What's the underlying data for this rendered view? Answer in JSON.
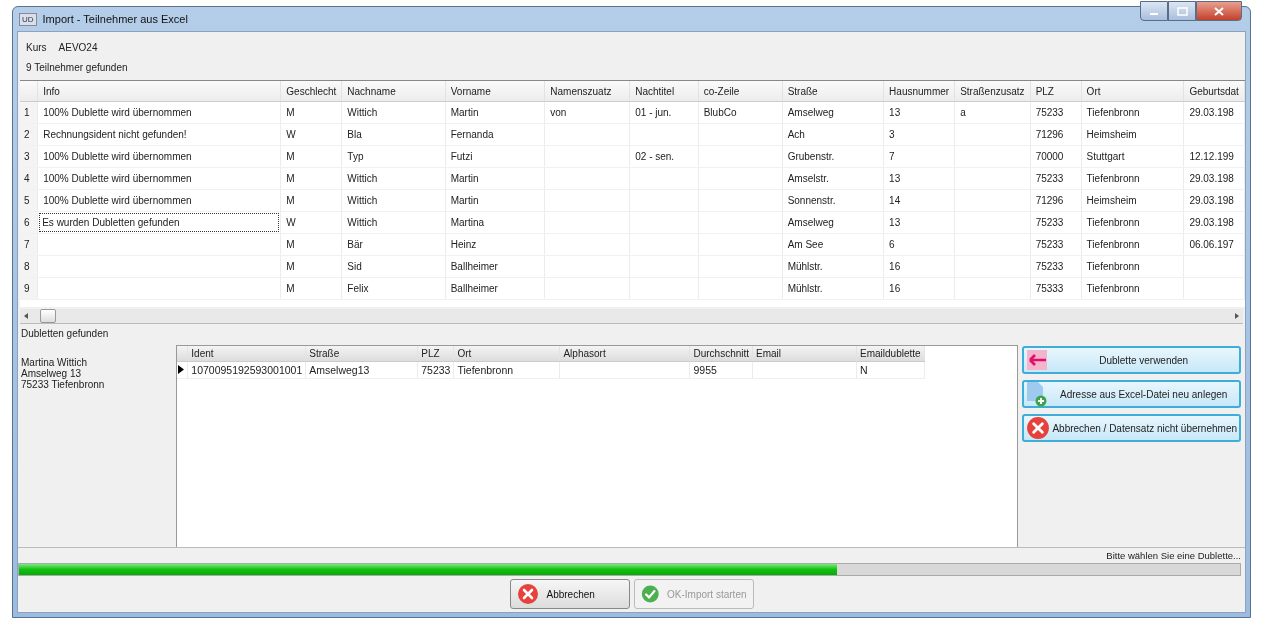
{
  "window": {
    "icon_text": "UD",
    "title": "Import - Teilnehmer aus Excel"
  },
  "course": {
    "label": "Kurs",
    "value": "AEVO24"
  },
  "found_text": "9 Teilnehmer gefunden",
  "main_table": {
    "columns": [
      "Info",
      "Geschlecht",
      "Nachname",
      "Vorname",
      "Namenszuatz",
      "Nachtitel",
      "co-Zeile",
      "Straße",
      "Hausnummer",
      "Straßenzusatz",
      "PLZ",
      "Ort",
      "Geburtsdat"
    ],
    "rows": [
      {
        "number": "1",
        "selected": false,
        "cells": [
          "100% Dublette wird übernommen",
          "M",
          "Wittich",
          "Martin",
          "von",
          "01 - jun.",
          "BlubCo",
          "Amselweg",
          "13",
          "a",
          "75233",
          "Tiefenbronn",
          "29.03.198"
        ]
      },
      {
        "number": "2",
        "selected": false,
        "cells": [
          "Rechnungsident nicht gefunden!",
          "W",
          "Bla",
          "Fernanda",
          "",
          "",
          "",
          "Ach",
          "3",
          "",
          "71296",
          "Heimsheim",
          ""
        ]
      },
      {
        "number": "3",
        "selected": false,
        "cells": [
          "100% Dublette wird übernommen",
          "M",
          "Typ",
          "Futzi",
          "",
          "02 - sen.",
          "",
          "Grubenstr.",
          "7",
          "",
          "70000",
          "Stuttgart",
          "12.12.199"
        ]
      },
      {
        "number": "4",
        "selected": false,
        "cells": [
          "100% Dublette wird übernommen",
          "M",
          "Wittich",
          "Martin",
          "",
          "",
          "",
          "Amselstr.",
          "13",
          "",
          "75233",
          "Tiefenbronn",
          "29.03.198"
        ]
      },
      {
        "number": "5",
        "selected": false,
        "cells": [
          "100% Dublette wird übernommen",
          "M",
          "Wittich",
          "Martin",
          "",
          "",
          "",
          "Sonnenstr.",
          "14",
          "",
          "71296",
          "Heimsheim",
          "29.03.198"
        ]
      },
      {
        "number": "6",
        "selected": true,
        "cells": [
          "Es wurden Dubletten gefunden",
          "W",
          "Wittich",
          "Martina",
          "",
          "",
          "",
          "Amselweg",
          "13",
          "",
          "75233",
          "Tiefenbronn",
          "29.03.198"
        ]
      },
      {
        "number": "7",
        "selected": false,
        "cells": [
          "",
          "M",
          "Bär",
          "Heinz",
          "",
          "",
          "",
          "Am See",
          "6",
          "",
          "75233",
          "Tiefenbronn",
          "06.06.197"
        ]
      },
      {
        "number": "8",
        "selected": false,
        "cells": [
          "",
          "M",
          "Sid",
          "Ballheimer",
          "",
          "",
          "",
          "Mühlstr.",
          "16",
          "",
          "75233",
          "Tiefenbronn",
          ""
        ]
      },
      {
        "number": "9",
        "selected": false,
        "cells": [
          "",
          "M",
          "Felix",
          "Ballheimer",
          "",
          "",
          "",
          "Mühlstr.",
          "16",
          "",
          "75333",
          "Tiefenbronn",
          ""
        ]
      }
    ]
  },
  "duplicates_label": "Dubletten gefunden",
  "address_lines": [
    "Martina Wittich",
    "Amselweg 13",
    "75233 Tiefenbronn"
  ],
  "duplicates_table": {
    "columns": [
      "Ident",
      "Straße",
      "PLZ",
      "Ort",
      "Alphasort",
      "Durchschnitt",
      "Email",
      "Emaildublette"
    ],
    "rows": [
      {
        "current": true,
        "cells": [
          "1070095192593001001",
          "Amselweg13",
          "75233",
          "Tiefenbronn",
          "",
          "9955",
          "",
          "N"
        ]
      }
    ]
  },
  "action_buttons": [
    {
      "kind": "use",
      "label": "Dublette verwenden"
    },
    {
      "kind": "new",
      "label": "Adresse aus Excel-Datei neu anlegen"
    },
    {
      "kind": "cancel",
      "label": "Abbrechen / Datensatz nicht übernehmen"
    }
  ],
  "status_text": "Bitte wählen Sie eine Dublette...",
  "progress": {
    "level": 0.67
  },
  "footer_buttons": [
    {
      "kind": "cancel",
      "label": "Abbrechen",
      "disabled": false
    },
    {
      "kind": "ok",
      "label": "OK-Import starten",
      "disabled": true
    }
  ]
}
